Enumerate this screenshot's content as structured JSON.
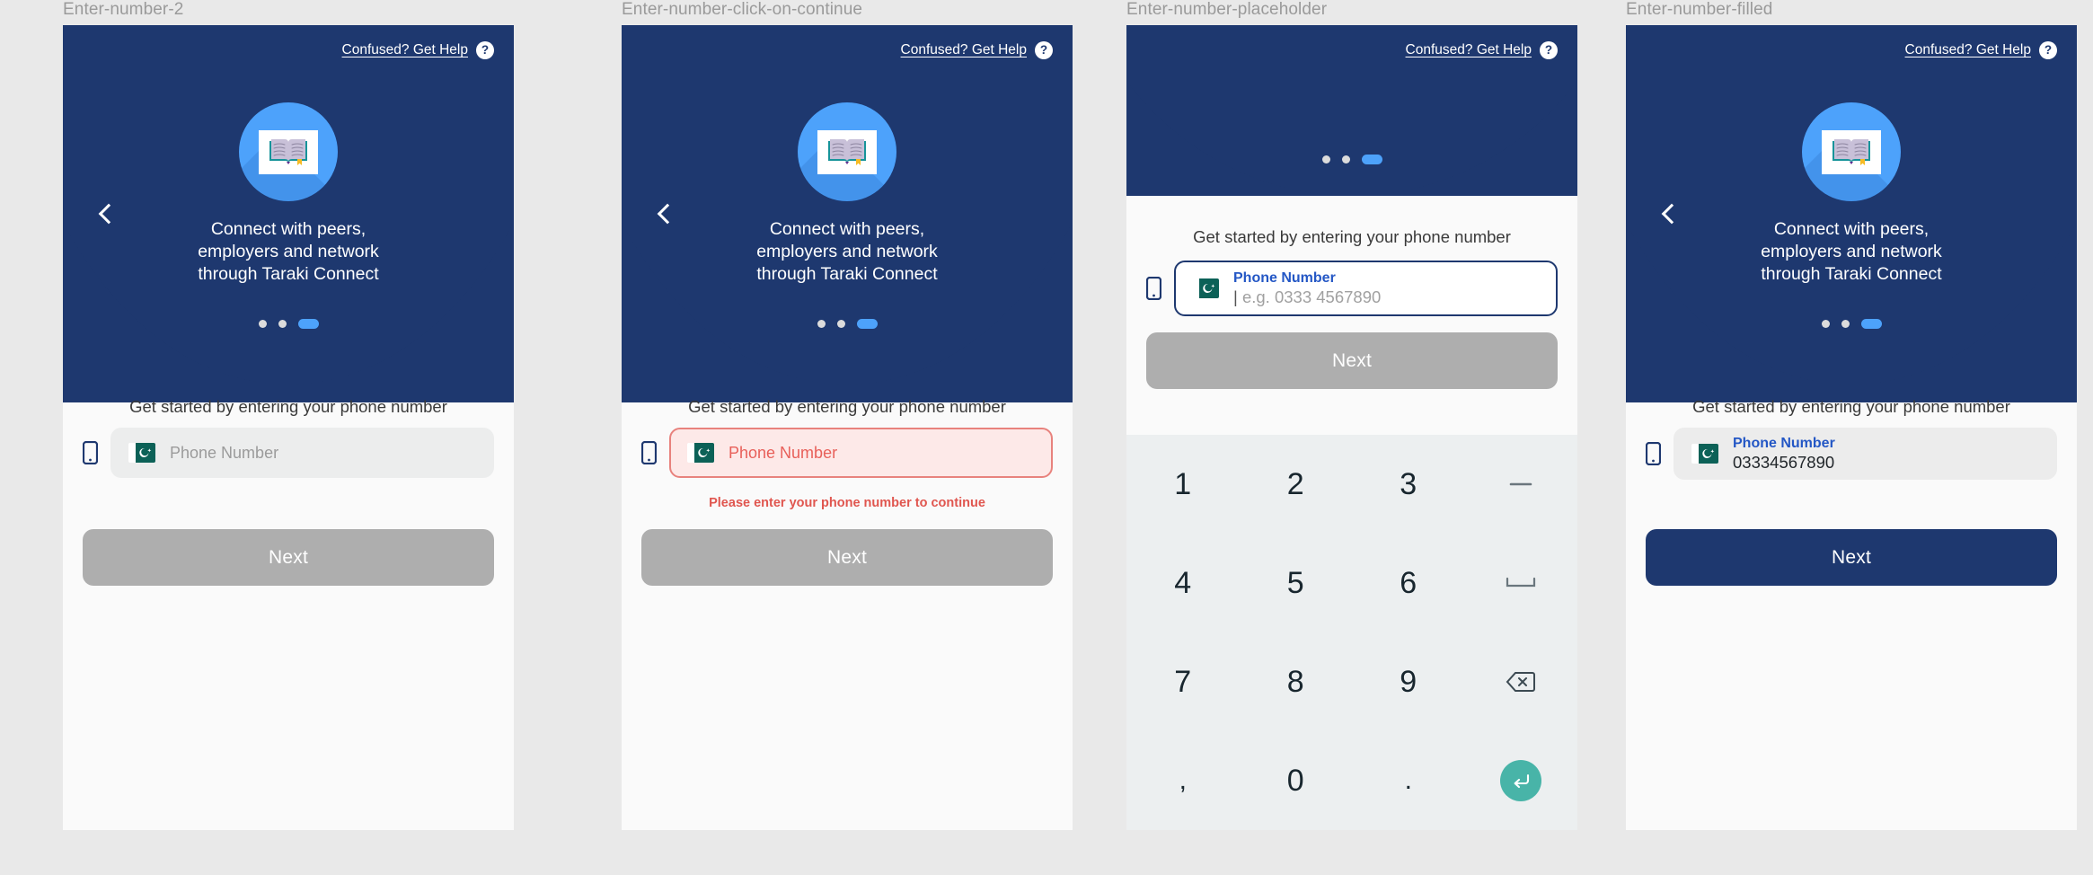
{
  "board": {
    "background": "#e9e9e9"
  },
  "theme": {
    "navy": "#1e386f",
    "blue_accent": "#4da2fb",
    "label_blue": "#2457c5",
    "error_red": "#e0564f",
    "error_bg": "#fde9e8",
    "disabled_gray": "#aeaeae",
    "flag_green": "#0c6157",
    "enter_teal": "#48b4a8",
    "screen_bg": "#fafafa",
    "keyboard_bg": "#eceff0"
  },
  "common": {
    "help_label": "Confused? Get Help",
    "help_icon": "question-mark-icon",
    "back_icon": "chevron-left-icon",
    "book_icon": "open-book-icon",
    "phone_icon": "mobile-phone-icon",
    "flag_icon": "pakistan-flag-icon",
    "tagline": "Connect with peers,\nemployers and network\nthrough Taraki Connect",
    "tagline_lines": [
      "Connect with peers,",
      "employers and network",
      "through Taraki Connect"
    ],
    "prompt": "Get started by entering your phone number",
    "next_label": "Next",
    "placeholder": "Phone Number",
    "field_label": "Phone Number",
    "dots": [
      {
        "active": false
      },
      {
        "active": false
      },
      {
        "active": true
      }
    ]
  },
  "frames": [
    {
      "id": "enter-number-2",
      "title": "Enter-number-2",
      "state": "empty",
      "show_hero_content": true,
      "field": {
        "mode": "placeholder",
        "placeholder": "Phone Number",
        "label": "",
        "value": ""
      },
      "error": "",
      "next": {
        "label": "Next",
        "enabled": false
      },
      "keyboard_visible": false
    },
    {
      "id": "enter-number-click-on-continue",
      "title": "Enter-number-click-on-continue",
      "state": "error",
      "show_hero_content": true,
      "field": {
        "mode": "error",
        "placeholder": "Phone Number",
        "label": "",
        "value": ""
      },
      "error": "Please enter your phone number to continue",
      "next": {
        "label": "Next",
        "enabled": false
      },
      "keyboard_visible": false
    },
    {
      "id": "enter-number-placeholder",
      "title": "Enter-number-placeholder",
      "state": "focused",
      "show_hero_content": false,
      "field": {
        "mode": "focused",
        "placeholder": "e.g. 0333 4567890",
        "label": "Phone Number",
        "value": ""
      },
      "error": "",
      "next": {
        "label": "Next",
        "enabled": false
      },
      "keyboard_visible": true
    },
    {
      "id": "enter-number-filled",
      "title": "Enter-number-filled",
      "state": "filled",
      "show_hero_content": true,
      "field": {
        "mode": "filled",
        "placeholder": "",
        "label": "Phone Number",
        "value": "03334567890"
      },
      "error": "",
      "next": {
        "label": "Next",
        "enabled": true
      },
      "keyboard_visible": false
    }
  ],
  "keyboard": {
    "keys": [
      {
        "label": "1",
        "name": "key-1",
        "type": "digit"
      },
      {
        "label": "2",
        "name": "key-2",
        "type": "digit"
      },
      {
        "label": "3",
        "name": "key-3",
        "type": "digit"
      },
      {
        "label": "–",
        "name": "key-dash",
        "type": "special"
      },
      {
        "label": "4",
        "name": "key-4",
        "type": "digit"
      },
      {
        "label": "5",
        "name": "key-5",
        "type": "digit"
      },
      {
        "label": "6",
        "name": "key-6",
        "type": "digit"
      },
      {
        "label": "␣",
        "name": "key-space",
        "type": "special"
      },
      {
        "label": "7",
        "name": "key-7",
        "type": "digit"
      },
      {
        "label": "8",
        "name": "key-8",
        "type": "digit"
      },
      {
        "label": "9",
        "name": "key-9",
        "type": "digit"
      },
      {
        "label": "⌫",
        "name": "key-backspace",
        "type": "special"
      },
      {
        "label": ",",
        "name": "key-comma",
        "type": "special"
      },
      {
        "label": "0",
        "name": "key-0",
        "type": "digit"
      },
      {
        "label": ".",
        "name": "key-period",
        "type": "special"
      },
      {
        "label": "↵",
        "name": "key-enter",
        "type": "enter"
      }
    ]
  }
}
